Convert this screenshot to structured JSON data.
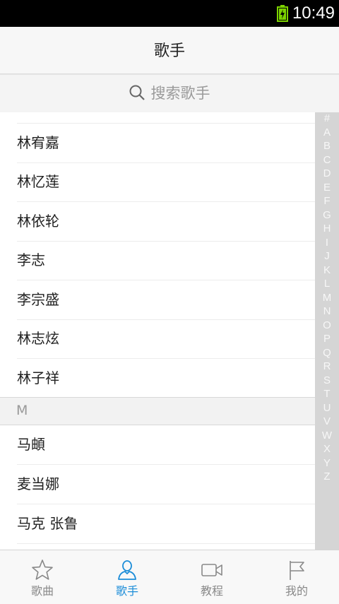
{
  "status_bar": {
    "time": "10:49"
  },
  "header": {
    "title": "歌手"
  },
  "search": {
    "placeholder": "搜索歌手"
  },
  "list": {
    "rows_before": [
      "林宥嘉",
      "林忆莲",
      "林依轮",
      "李志",
      "李宗盛",
      "林志炫",
      "林子祥"
    ],
    "section_header": "M",
    "rows_after": [
      "马頔",
      "麦当娜",
      "马克 张鲁"
    ]
  },
  "index_letters": [
    "#",
    "A",
    "B",
    "C",
    "D",
    "E",
    "F",
    "G",
    "H",
    "I",
    "J",
    "K",
    "L",
    "M",
    "N",
    "O",
    "P",
    "Q",
    "R",
    "S",
    "T",
    "U",
    "V",
    "W",
    "X",
    "Y",
    "Z"
  ],
  "tabs": [
    {
      "label": "歌曲",
      "icon": "star-icon",
      "active": false
    },
    {
      "label": "歌手",
      "icon": "person-icon",
      "active": true
    },
    {
      "label": "教程",
      "icon": "video-icon",
      "active": false
    },
    {
      "label": "我的",
      "icon": "flag-icon",
      "active": false
    }
  ],
  "colors": {
    "accent": "#1a8cd8",
    "battery": "#7cd300",
    "inactive_tab": "#888888"
  }
}
